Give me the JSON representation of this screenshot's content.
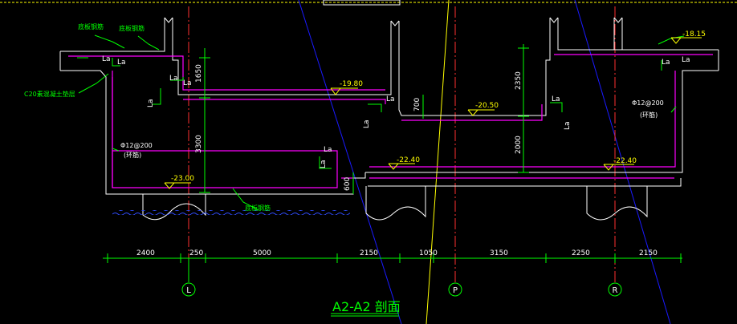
{
  "drawing": {
    "title": "A2-A2 剖面",
    "colors": {
      "background": "#000000",
      "wall": "#ffffff",
      "rebar": "#ff00ff",
      "dimension": "#00ff00",
      "axis": "#ff3030",
      "elevation": "#ffff00",
      "label_green": "#00ff00",
      "water_line": "#2f4bff",
      "guide_blue": "#1a1aff",
      "guide_yellow": "#ffff00"
    },
    "elevations": [
      "-18.15",
      "-19.80",
      "-20.50",
      "-22.40",
      "-22.40",
      "-23.00"
    ],
    "bottom_dimensions": [
      "2400",
      "250",
      "5000",
      "2150",
      "1050",
      "3150",
      "2250",
      "2150"
    ],
    "vertical_dimensions": [
      "1650",
      "3300",
      "2350",
      "2000",
      "700",
      "600"
    ],
    "lap_labels": [
      "La",
      "La",
      "La",
      "La",
      "La",
      "La",
      "La",
      "La",
      "La",
      "La",
      "La",
      "La",
      "La"
    ],
    "rebar_notes": [
      "Φ12@200",
      "(环筋)",
      "Φ12@200",
      "(环筋)"
    ],
    "annotations": [
      "底板钢筋",
      "底板钢筋",
      "C20素混凝土垫层",
      "底板钢筋"
    ],
    "axis_labels": [
      "L",
      "P",
      "R"
    ]
  }
}
